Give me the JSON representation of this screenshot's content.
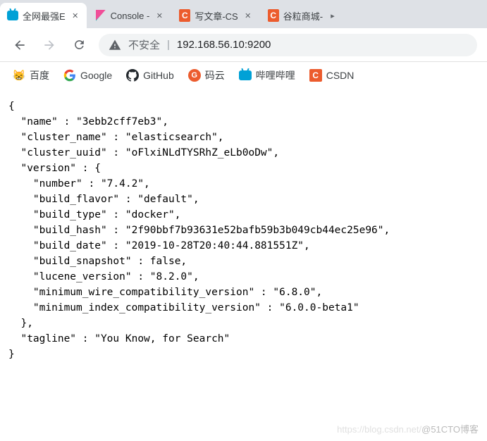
{
  "tabs": [
    {
      "title": "全网最强E",
      "icon": "bilibili"
    },
    {
      "title": "Console -",
      "icon": "kibana"
    },
    {
      "title": "写文章-CS",
      "icon": "csdn"
    },
    {
      "title": "谷粒商城-",
      "icon": "csdn"
    }
  ],
  "addressBar": {
    "securityLabel": "不安全",
    "url": "192.168.56.10:9200"
  },
  "bookmarks": [
    {
      "label": "百度",
      "icon": "baidu"
    },
    {
      "label": "Google",
      "icon": "google"
    },
    {
      "label": "GitHub",
      "icon": "github"
    },
    {
      "label": "码云",
      "icon": "gitee"
    },
    {
      "label": "哔哩哔哩",
      "icon": "bilibili"
    },
    {
      "label": "CSDN",
      "icon": "csdn"
    }
  ],
  "response": {
    "name": "3ebb2cff7eb3",
    "cluster_name": "elasticsearch",
    "cluster_uuid": "oFlxiNLdTYSRhZ_eLb0oDw",
    "version": {
      "number": "7.4.2",
      "build_flavor": "default",
      "build_type": "docker",
      "build_hash": "2f90bbf7b93631e52bafb59b3b049cb44ec25e96",
      "build_date": "2019-10-28T20:40:44.881551Z",
      "build_snapshot": "false",
      "lucene_version": "8.2.0",
      "minimum_wire_compatibility_version": "6.8.0",
      "minimum_index_compatibility_version": "6.0.0-beta1"
    },
    "tagline": "You Know, for Search"
  },
  "watermark": {
    "light": "https://blog.csdn.net/",
    "text": "@51CTO博客"
  }
}
